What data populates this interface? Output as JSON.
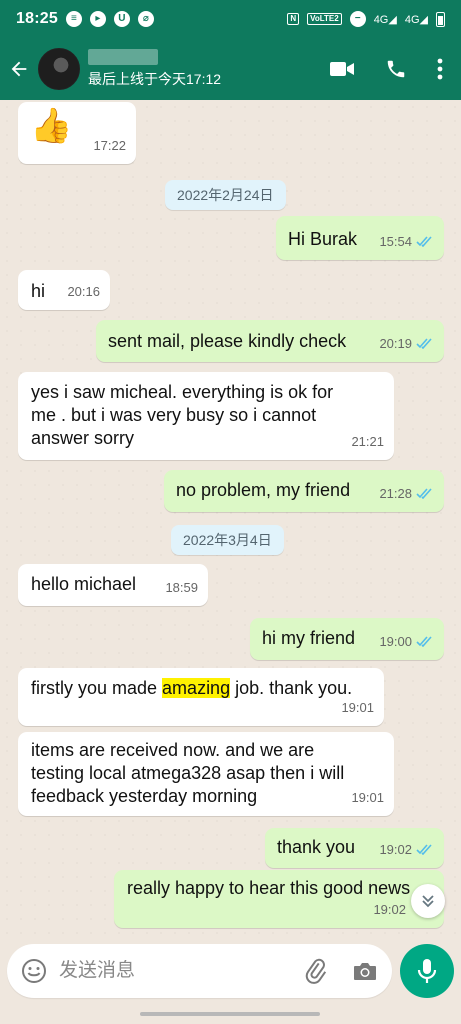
{
  "status_bar": {
    "time": "18:25",
    "nfc": "N",
    "volte": "VoLTE2",
    "signal1": "4G",
    "signal2": "4G"
  },
  "header": {
    "last_seen": "最后上线于今天17:12"
  },
  "messages": [
    {
      "dir": "in",
      "emoji": "👍",
      "time": "17:22"
    },
    {
      "date": "2022年2月24日"
    },
    {
      "dir": "out",
      "text": "Hi Burak",
      "time": "15:54"
    },
    {
      "dir": "in",
      "text": "hi",
      "time": "20:16"
    },
    {
      "dir": "out",
      "text": "sent mail, please kindly check",
      "time": "20:19"
    },
    {
      "dir": "in",
      "text": "yes i saw micheal. everything is ok for me . but i was very busy so i cannot answer sorry",
      "time": "21:21"
    },
    {
      "dir": "out",
      "text": "no problem, my friend",
      "time": "21:28"
    },
    {
      "date": "2022年3月4日"
    },
    {
      "dir": "in",
      "text": "hello michael",
      "time": "18:59"
    },
    {
      "dir": "out",
      "text": "hi my friend",
      "time": "19:00"
    },
    {
      "dir": "in",
      "text_before": "firstly you made ",
      "highlight": "amazing",
      "text_after": " job. thank you.",
      "time": "19:01"
    },
    {
      "dir": "in",
      "text": "items are received now. and we are testing local atmega328 asap then i will feedback yesterday morning",
      "time": "19:01"
    },
    {
      "dir": "out",
      "text": "thank you",
      "time": "19:02"
    },
    {
      "dir": "out",
      "text": "really happy to hear this good news",
      "time": "19:02"
    }
  ],
  "composer": {
    "placeholder": "发送消息"
  },
  "colors": {
    "header": "#0e7a5e",
    "outgoing_bubble": "#dcf8c6",
    "incoming_bubble": "#ffffff",
    "read_ticks": "#53bdeb",
    "mic_button": "#00a884",
    "highlight": "#fff200"
  },
  "icons": [
    "back-arrow-icon",
    "video-call-icon",
    "phone-icon",
    "more-options-icon",
    "emoji-icon",
    "attach-icon",
    "camera-icon",
    "mic-icon",
    "scroll-down-icon",
    "read-ticks-icon"
  ]
}
